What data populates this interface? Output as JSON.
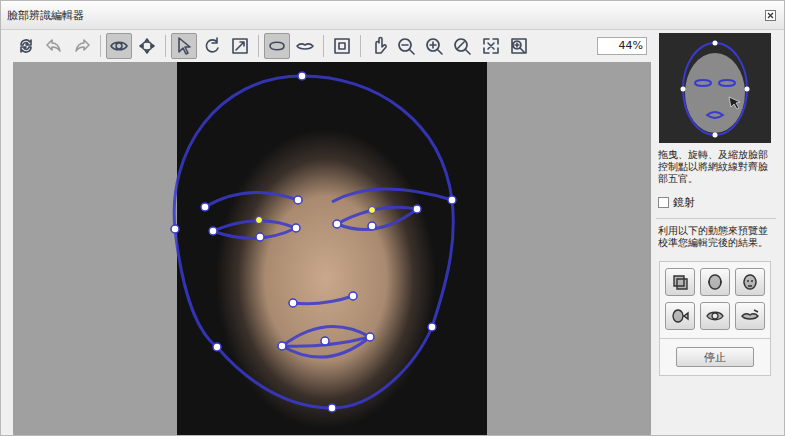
{
  "window": {
    "title": "臉部辨識編輯器"
  },
  "toolbar": [
    {
      "selected": false,
      "disabled": false
    },
    {
      "selected": false,
      "disabled": true
    },
    {
      "selected": false,
      "disabled": true
    },
    {
      "selected": true,
      "disabled": false
    },
    {
      "selected": false,
      "disabled": false
    },
    {
      "selected": true,
      "disabled": false
    },
    {
      "selected": false,
      "disabled": false
    },
    {
      "selected": false,
      "disabled": false
    },
    {
      "selected": true,
      "disabled": false
    },
    {
      "selected": false,
      "disabled": false
    },
    {
      "selected": false,
      "disabled": false
    },
    {
      "selected": false,
      "disabled": false
    },
    {
      "selected": false,
      "disabled": false
    },
    {
      "selected": false,
      "disabled": false
    },
    {
      "selected": false,
      "disabled": false
    },
    {
      "selected": false,
      "disabled": false
    },
    {
      "selected": false,
      "disabled": false
    }
  ],
  "zoom": "44%",
  "instructions": "拖曳、旋轉、及縮放臉部控制點以將網紋線對齊臉部五官。",
  "mirror": {
    "label": "鏡射",
    "checked": false
  },
  "preview": {
    "text": "利用以下的動態來預覽並校準您編輯完後的結果。",
    "buttons": [
      {
        "selected": false
      },
      {
        "selected": false
      },
      {
        "selected": false
      },
      {
        "selected": false
      },
      {
        "selected": false
      },
      {
        "selected": false
      }
    ],
    "stop": "停止"
  }
}
